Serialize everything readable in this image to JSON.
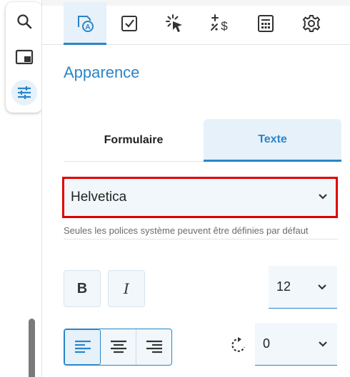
{
  "side_toolbar": {
    "items": [
      {
        "icon": "search-icon",
        "active": false
      },
      {
        "icon": "window-icon",
        "active": false
      },
      {
        "icon": "tune-sliders-icon",
        "active": true
      }
    ]
  },
  "tabs": [
    {
      "icon": "appearance-text-icon",
      "active": true
    },
    {
      "icon": "checkbox-icon",
      "active": false
    },
    {
      "icon": "click-cursor-icon",
      "active": false
    },
    {
      "icon": "calculation-icon",
      "active": false
    },
    {
      "icon": "calculator-icon",
      "active": false
    },
    {
      "icon": "settings-gear-icon",
      "active": false
    }
  ],
  "panel": {
    "title": "Apparence",
    "segments": {
      "form": "Formulaire",
      "text": "Texte",
      "active": "text"
    },
    "font": {
      "value": "Helvetica"
    },
    "font_hint": "Seules les polices système peuvent être définies par défaut",
    "format": {
      "bold_label": "B",
      "italic_label": "I"
    },
    "font_size": {
      "value": "12"
    },
    "alignment": {
      "options": [
        "left",
        "center",
        "right"
      ],
      "selected": "left"
    },
    "rotation": {
      "value": "0"
    }
  },
  "colors": {
    "accent": "#2a85c7",
    "active_bg": "#e6f1fa",
    "highlight_border": "#e00000"
  }
}
